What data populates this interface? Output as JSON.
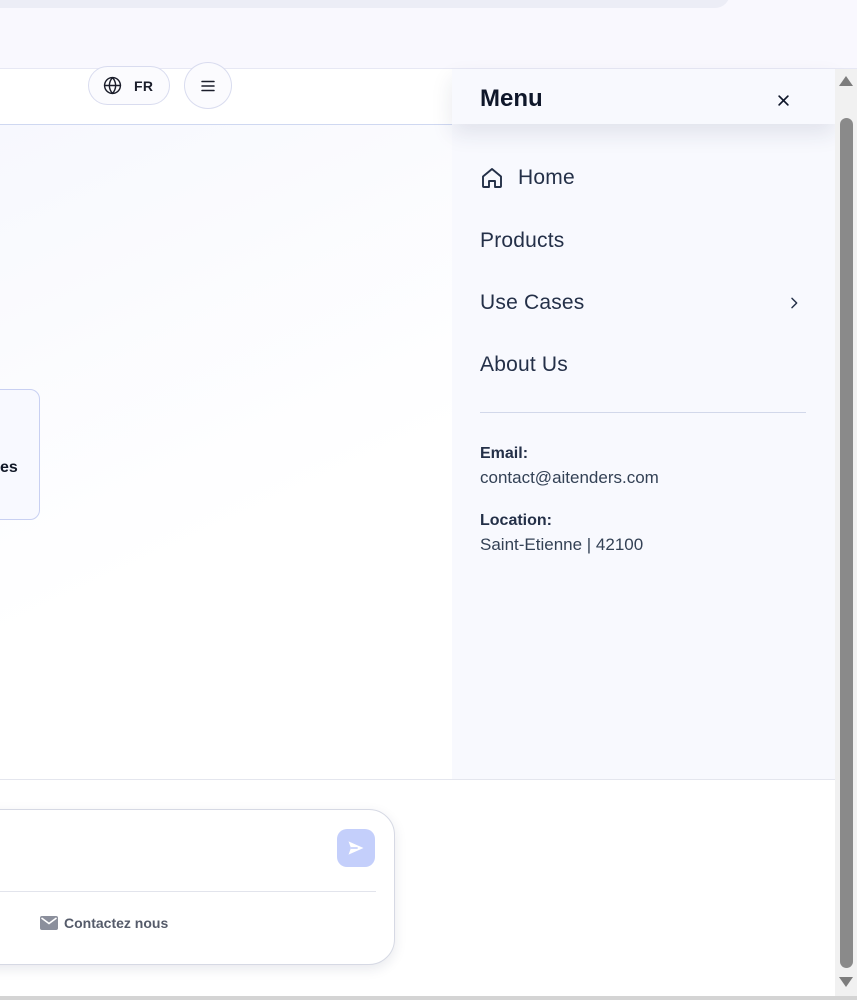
{
  "header": {
    "language_code": "FR",
    "language_icon": "globe-icon",
    "menu_icon": "hamburger-icon"
  },
  "main": {
    "card_text_fragment": "es"
  },
  "drawer": {
    "title": "Menu",
    "close_icon": "close-icon",
    "items": [
      {
        "label": "Home",
        "icon": "home-icon"
      },
      {
        "label": "Products"
      },
      {
        "label": "Use Cases",
        "icon": "chevron-right-icon"
      },
      {
        "label": "About Us"
      }
    ],
    "email_label": "Email:",
    "email_value": "contact@aitenders.com",
    "location_label": "Location:",
    "location_value": "Saint-Etienne | 42100"
  },
  "chat": {
    "input_value": "",
    "send_icon": "send-icon",
    "contact_label": "Contactez nous",
    "contact_icon": "mail-icon"
  },
  "colors": {
    "drawer_bg": "#f8f9fe",
    "send_button": "#c4cffb",
    "text_primary": "#243048",
    "scroll_thumb": "#8a8a8a"
  }
}
